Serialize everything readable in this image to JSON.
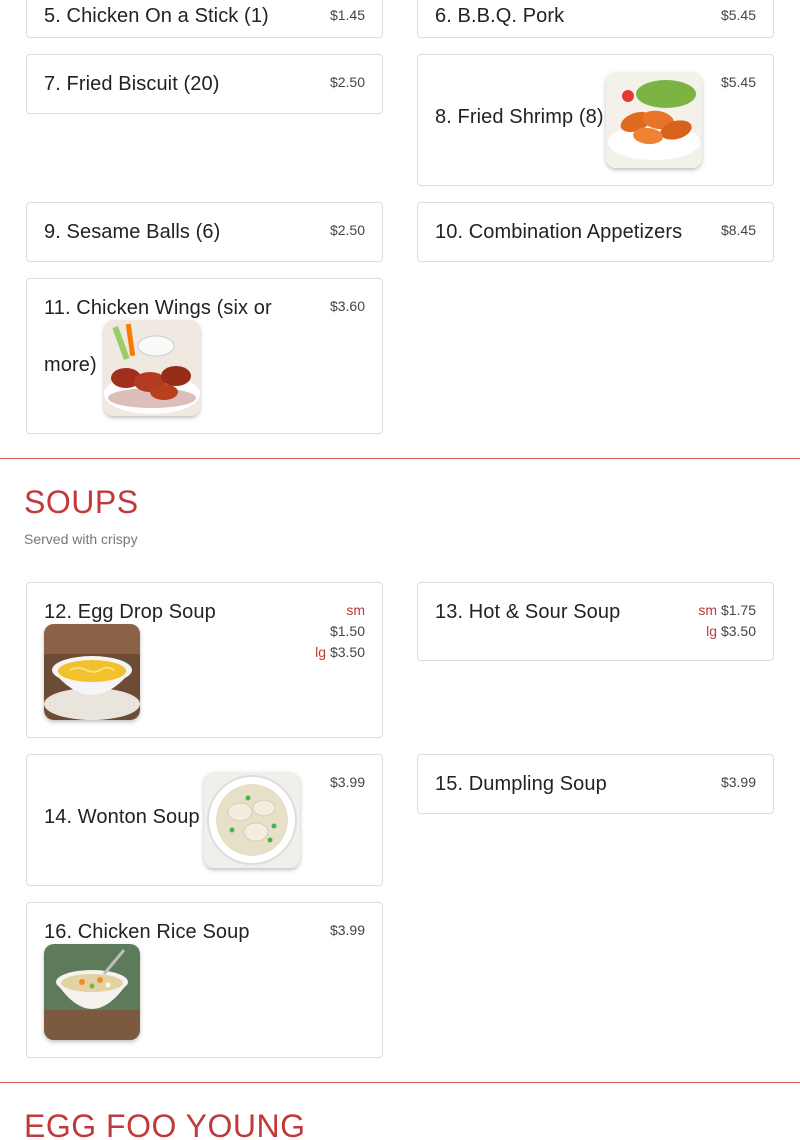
{
  "appetizers": {
    "items": [
      {
        "name": "5. Chicken On a Stick (1)",
        "price": "$1.45"
      },
      {
        "name": "6. B.B.Q. Pork",
        "price": "$5.45"
      },
      {
        "name": "7. Fried Biscuit (20)",
        "price": "$2.50"
      },
      {
        "name": "8. Fried Shrimp (8)",
        "price": "$5.45",
        "image": "fried-shrimp-photo"
      },
      {
        "name": "9. Sesame Balls (6)",
        "price": "$2.50"
      },
      {
        "name": "10. Combination Appetizers",
        "price": "$8.45"
      },
      {
        "name_line1": "11. Chicken Wings (six or",
        "name_line2": "more)",
        "price": "$3.60",
        "image": "chicken-wings-photo"
      }
    ]
  },
  "soups": {
    "title": "SOUPS",
    "subtitle": "Served with crispy",
    "items": [
      {
        "name": "12. Egg Drop Soup",
        "sm_label": "sm",
        "sm_price": "$1.50",
        "lg_label": "lg",
        "lg_price": "$3.50",
        "image": "egg-drop-soup-photo"
      },
      {
        "name": "13. Hot & Sour Soup",
        "sm_label": "sm",
        "sm_price": "$1.75",
        "lg_label": "lg",
        "lg_price": "$3.50"
      },
      {
        "name": "14. Wonton Soup",
        "price": "$3.99",
        "image": "wonton-soup-photo"
      },
      {
        "name": "15. Dumpling Soup",
        "price": "$3.99"
      },
      {
        "name": "16. Chicken Rice Soup",
        "price": "$3.99",
        "image": "chicken-rice-soup-photo"
      }
    ]
  },
  "egg_foo_young": {
    "title": "EGG FOO YOUNG"
  },
  "colors": {
    "accent": "#c0393b",
    "border": "#dcdcdc",
    "divider": "#c75a5a"
  }
}
